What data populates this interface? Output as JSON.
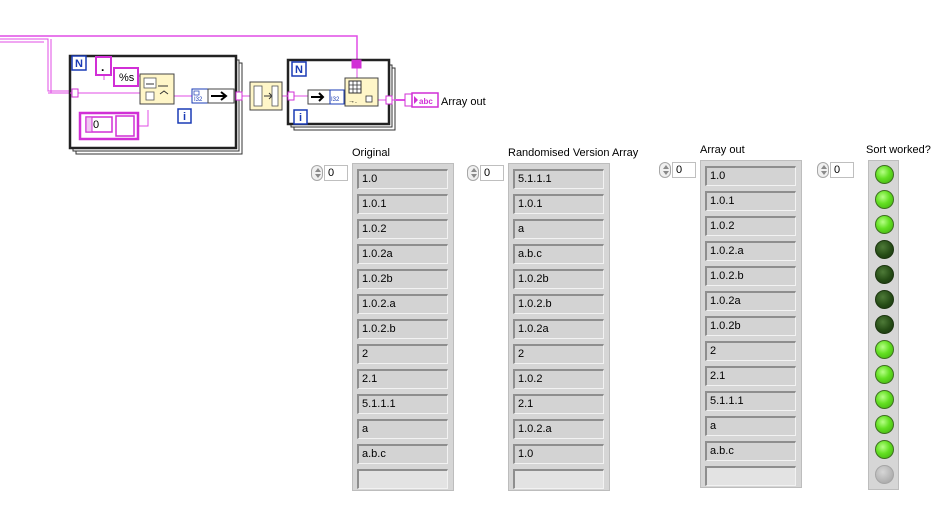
{
  "block_diagram": {
    "loop1": {
      "count_terminal": "N",
      "iteration_terminal": "i",
      "format_string": "%s",
      "delimiter_constant": ".",
      "numeric_constant": "0"
    },
    "loop2": {
      "count_terminal": "N",
      "iteration_terminal": "i"
    },
    "indicator": {
      "type_badge": "abc",
      "label": "Array out"
    },
    "wire_color": "#e04de6"
  },
  "arrays": {
    "original": {
      "label": "Original",
      "index": "0",
      "items": [
        "1.0",
        "1.0.1",
        "1.0.2",
        "1.0.2a",
        "1.0.2b",
        "1.0.2.a",
        "1.0.2.b",
        "2",
        "2.1",
        "5.1.1.1",
        "a",
        "a.b.c"
      ]
    },
    "randomised": {
      "label": "Randomised Version Array",
      "index": "0",
      "items": [
        "5.1.1.1",
        "1.0.1",
        "a",
        "a.b.c",
        "1.0.2b",
        "1.0.2.b",
        "1.0.2a",
        "2",
        "1.0.2",
        "2.1",
        "1.0.2.a",
        "1.0"
      ]
    },
    "array_out": {
      "label": "Array out",
      "index": "0",
      "items": [
        "1.0",
        "1.0.1",
        "1.0.2",
        "1.0.2.a",
        "1.0.2.b",
        "1.0.2a",
        "1.0.2b",
        "2",
        "2.1",
        "5.1.1.1",
        "a",
        "a.b.c"
      ]
    },
    "sort_worked": {
      "label": "Sort worked?",
      "index": "0",
      "leds": [
        true,
        true,
        true,
        false,
        false,
        false,
        false,
        true,
        true,
        true,
        true,
        true
      ]
    }
  },
  "colors": {
    "led_on": "#63e022",
    "led_off": "#264d16",
    "cell_bg": "#d3d3d3",
    "frame_bg": "#d6d6d6"
  }
}
